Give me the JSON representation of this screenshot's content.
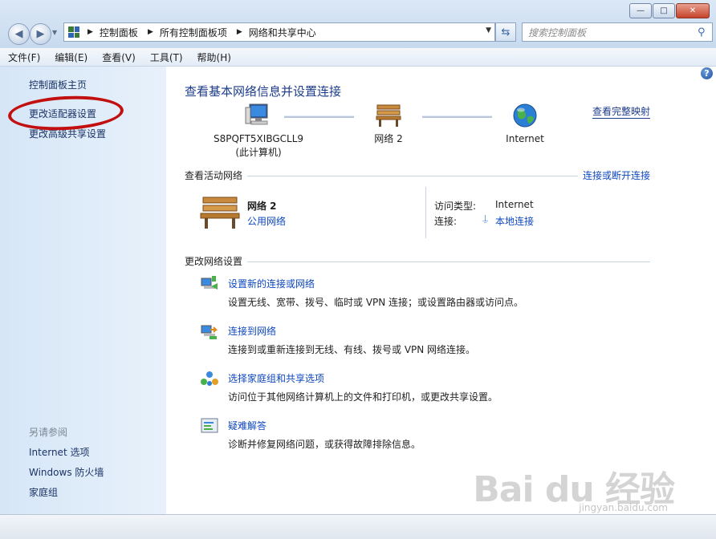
{
  "window": {
    "buttons": {
      "minimize": "—",
      "maximize": "□",
      "close": "✕"
    }
  },
  "nav": {
    "breadcrumbs": [
      "控制面板",
      "所有控制面板项",
      "网络和共享中心"
    ],
    "search_placeholder": "搜索控制面板"
  },
  "menu": [
    "文件(F)",
    "编辑(E)",
    "查看(V)",
    "工具(T)",
    "帮助(H)"
  ],
  "sidebar": {
    "home": "控制面板主页",
    "adapter": "更改适配器设置",
    "advanced": "更改高级共享设置",
    "see_also": "另请参阅",
    "links": [
      "Internet 选项",
      "Windows 防火墙",
      "家庭组"
    ]
  },
  "main": {
    "heading": "查看基本网络信息并设置连接",
    "full_map": "查看完整映射",
    "computer_name": "S8PQFT5XIBGCLL9",
    "computer_sub": "(此计算机)",
    "network_node": "网络  2",
    "internet_node": "Internet",
    "active_label": "查看活动网络",
    "connect_toggle": "连接或断开连接",
    "active_net_name": "网络  2",
    "active_net_type": "公用网络",
    "access_type_label": "访问类型:",
    "access_type_value": "Internet",
    "connections_label": "连接:",
    "connections_value": "本地连接",
    "change_label": "更改网络设置",
    "tasks": [
      {
        "title": "设置新的连接或网络",
        "desc": "设置无线、宽带、拨号、临时或 VPN 连接；或设置路由器或访问点。"
      },
      {
        "title": "连接到网络",
        "desc": "连接到或重新连接到无线、有线、拨号或 VPN 网络连接。"
      },
      {
        "title": "选择家庭组和共享选项",
        "desc": "访问位于其他网络计算机上的文件和打印机，或更改共享设置。"
      },
      {
        "title": "疑难解答",
        "desc": "诊断并修复网络问题，或获得故障排除信息。"
      }
    ]
  },
  "watermark": {
    "brand": "Bai du 经验",
    "url": "jingyan.baidu.com"
  },
  "colors": {
    "link": "#0d47c1",
    "heading": "#1c3b8a",
    "sidebar_bg": "#d6e6f7",
    "annotation": "#c20f0f"
  }
}
